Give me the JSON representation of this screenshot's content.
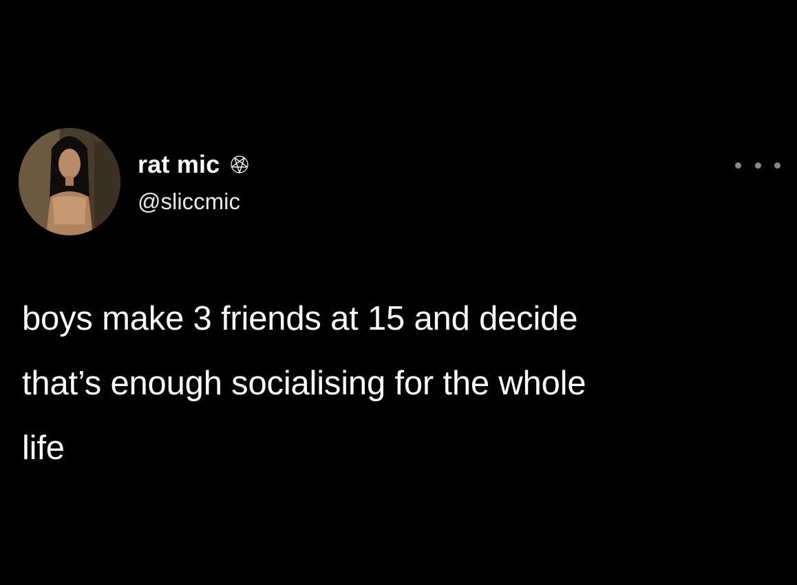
{
  "tweet": {
    "author": {
      "display_name": "rat mic",
      "handle": "@sliccmic",
      "badge_icon": "pentagram-icon",
      "avatar_icon": "profile-photo"
    },
    "more_icon": "more-options-icon",
    "text": "boys make 3 friends at 15 and decide\nthat’s enough socialising for the whole\nlife"
  },
  "colors": {
    "background": "#000000",
    "text": "#ffffff",
    "muted": "#8a8a8a"
  }
}
